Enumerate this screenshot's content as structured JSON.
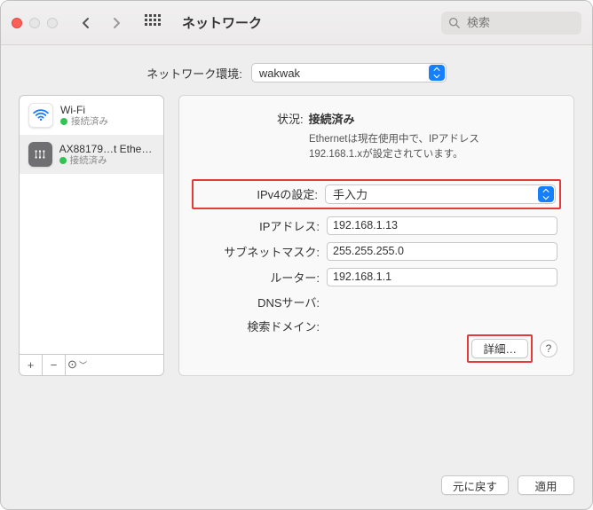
{
  "window": {
    "title": "ネットワーク",
    "search_placeholder": "検索"
  },
  "location": {
    "label": "ネットワーク環境:",
    "selected": "wakwak"
  },
  "sidebar": {
    "items": [
      {
        "name": "Wi-Fi",
        "status": "接続済み",
        "icon": "wifi"
      },
      {
        "name": "AX88179…t Ethernet",
        "status": "接続済み",
        "icon": "ethernet"
      }
    ],
    "footer": {
      "add": "+",
      "remove": "−",
      "more": "⊙"
    }
  },
  "status": {
    "label": "状況:",
    "value": "接続済み",
    "desc_line1": "Ethernetは現在使用中で、IPアドレス",
    "desc_line2": "192.168.1.xが設定されています。"
  },
  "form": {
    "ipv4_label": "IPv4の設定:",
    "ipv4_value": "手入力",
    "ip_label": "IPアドレス:",
    "ip_value": "192.168.1.13",
    "subnet_label": "サブネットマスク:",
    "subnet_value": "255.255.255.0",
    "router_label": "ルーター:",
    "router_value": "192.168.1.1",
    "dns_label": "DNSサーバ:",
    "search_domain_label": "検索ドメイン:"
  },
  "buttons": {
    "advanced": "詳細…",
    "help": "?",
    "revert": "元に戻す",
    "apply": "適用"
  }
}
